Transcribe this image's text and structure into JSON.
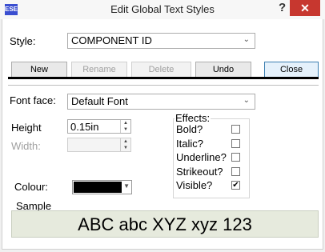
{
  "window": {
    "icon_text": "ESE",
    "title": "Edit Global Text Styles",
    "help_label": "?",
    "close_label": "✕"
  },
  "style": {
    "label": "Style:",
    "value": "COMPONENT ID"
  },
  "toolbar": {
    "new_label": "New",
    "rename_label": "Rename",
    "delete_label": "Delete",
    "undo_label": "Undo",
    "close_label": "Close"
  },
  "font_face": {
    "label": "Font face:",
    "value": "Default Font"
  },
  "height": {
    "label": "Height",
    "value": "0.15in"
  },
  "width": {
    "label": "Width:",
    "value": ""
  },
  "effects": {
    "title": "Effects:",
    "items": [
      {
        "label": "Bold?",
        "checked": false
      },
      {
        "label": "Italic?",
        "checked": false
      },
      {
        "label": "Underline?",
        "checked": false
      },
      {
        "label": "Strikeout?",
        "checked": false
      },
      {
        "label": "Visible?",
        "checked": true
      }
    ]
  },
  "colour": {
    "label": "Colour:",
    "value_color": "#000000"
  },
  "sample": {
    "label": "Sample",
    "text": "ABC abc XYZ xyz 123"
  }
}
